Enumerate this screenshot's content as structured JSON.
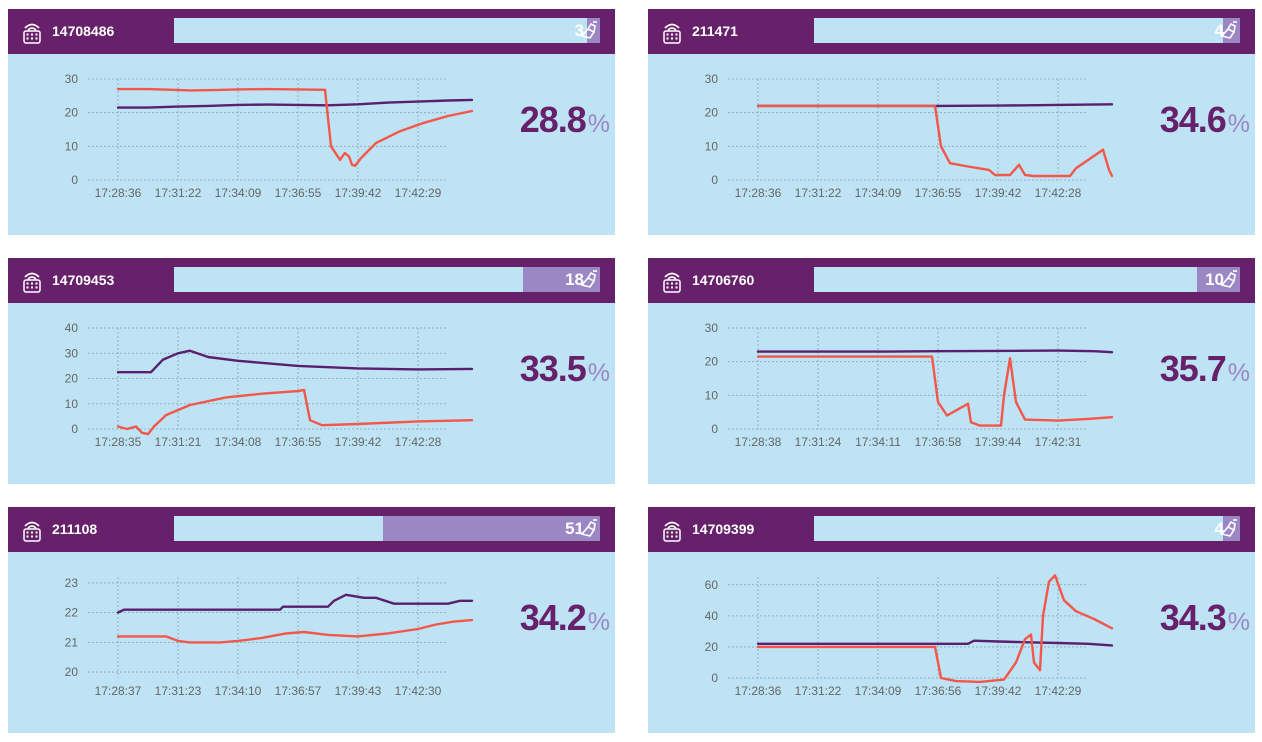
{
  "colors": {
    "header": "#67206a",
    "panel": "#bde3f4",
    "bar_fill": "#9a87c4",
    "series_dark": "#5a1f6e",
    "series_red": "#f5564a"
  },
  "icons": {
    "device": "device-wifi-icon",
    "bar": "hand-sanitizer-icon"
  },
  "devices": [
    {
      "id": "14708486",
      "bar_value": 3,
      "bar_label": "3",
      "humidity": "28.8",
      "pct_symbol": "%",
      "chart_data": {
        "type": "line",
        "xlabels": [
          "17:28:36",
          "17:31:22",
          "17:34:09",
          "17:36:55",
          "17:39:42",
          "17:42:29"
        ],
        "yticks": [
          0,
          10,
          20,
          30
        ],
        "ylim": [
          0,
          30
        ],
        "series": [
          {
            "color": "#5a1f6e",
            "points": [
              [
                0,
                21.5
              ],
              [
                0.5,
                21.5
              ],
              [
                1,
                21.8
              ],
              [
                1.5,
                22
              ],
              [
                2,
                22.3
              ],
              [
                2.5,
                22.4
              ],
              [
                3,
                22.3
              ],
              [
                3.5,
                22.2
              ],
              [
                4,
                22.5
              ],
              [
                4.5,
                23
              ],
              [
                5,
                23.3
              ],
              [
                5.5,
                23.6
              ],
              [
                5.9,
                23.8
              ]
            ]
          },
          {
            "color": "#f5564a",
            "points": [
              [
                0,
                27
              ],
              [
                0.5,
                27
              ],
              [
                0.9,
                26.8
              ],
              [
                1.2,
                26.6
              ],
              [
                1.6,
                26.7
              ],
              [
                2,
                26.9
              ],
              [
                2.5,
                27
              ],
              [
                3,
                26.9
              ],
              [
                3.45,
                26.8
              ],
              [
                3.55,
                10
              ],
              [
                3.7,
                6
              ],
              [
                3.78,
                8
              ],
              [
                3.85,
                7
              ],
              [
                3.9,
                4.5
              ],
              [
                3.95,
                4.2
              ],
              [
                4.05,
                6.5
              ],
              [
                4.3,
                11
              ],
              [
                4.7,
                14.5
              ],
              [
                5.1,
                17
              ],
              [
                5.5,
                19
              ],
              [
                5.9,
                20.5
              ]
            ]
          }
        ]
      }
    },
    {
      "id": "211471",
      "bar_value": 4,
      "bar_label": "4",
      "humidity": "34.6",
      "pct_symbol": "%",
      "chart_data": {
        "type": "line",
        "xlabels": [
          "17:28:36",
          "17:31:22",
          "17:34:09",
          "17:36:55",
          "17:39:42",
          "17:42:28"
        ],
        "yticks": [
          0,
          10,
          20,
          30
        ],
        "ylim": [
          0,
          30
        ],
        "series": [
          {
            "color": "#5a1f6e",
            "points": [
              [
                0,
                22
              ],
              [
                1,
                22
              ],
              [
                2,
                22
              ],
              [
                3,
                22
              ],
              [
                4,
                22.1
              ],
              [
                5,
                22.3
              ],
              [
                5.9,
                22.5
              ]
            ]
          },
          {
            "color": "#f5564a",
            "points": [
              [
                0,
                22
              ],
              [
                1,
                22
              ],
              [
                2,
                22
              ],
              [
                2.95,
                22
              ],
              [
                3.05,
                10
              ],
              [
                3.2,
                5
              ],
              [
                3.5,
                4
              ],
              [
                3.85,
                3
              ],
              [
                3.95,
                1.5
              ],
              [
                4.2,
                1.5
              ],
              [
                4.35,
                4.5
              ],
              [
                4.45,
                1.5
              ],
              [
                4.6,
                1.2
              ],
              [
                5,
                1.2
              ],
              [
                5.2,
                1.2
              ],
              [
                5.3,
                3.5
              ],
              [
                5.75,
                9
              ],
              [
                5.85,
                3
              ],
              [
                5.9,
                1.2
              ]
            ]
          }
        ]
      }
    },
    {
      "id": "14709453",
      "bar_value": 18,
      "bar_label": "18",
      "humidity": "33.5",
      "pct_symbol": "%",
      "chart_data": {
        "type": "line",
        "xlabels": [
          "17:28:35",
          "17:31:21",
          "17:34:08",
          "17:36:55",
          "17:39:42",
          "17:42:28"
        ],
        "yticks": [
          0,
          10,
          20,
          30,
          40
        ],
        "ylim": [
          0,
          40
        ],
        "series": [
          {
            "color": "#5a1f6e",
            "points": [
              [
                0,
                22.5
              ],
              [
                0.55,
                22.5
              ],
              [
                0.75,
                27.5
              ],
              [
                1,
                30
              ],
              [
                1.2,
                31
              ],
              [
                1.5,
                28.5
              ],
              [
                2,
                27
              ],
              [
                3,
                25
              ],
              [
                4,
                24
              ],
              [
                5,
                23.6
              ],
              [
                5.9,
                23.8
              ]
            ]
          },
          {
            "color": "#f5564a",
            "points": [
              [
                0,
                1
              ],
              [
                0.15,
                0
              ],
              [
                0.3,
                1
              ],
              [
                0.4,
                -1.5
              ],
              [
                0.5,
                -2
              ],
              [
                0.6,
                1
              ],
              [
                0.8,
                5.5
              ],
              [
                1.2,
                9.5
              ],
              [
                1.8,
                12.5
              ],
              [
                2.4,
                14
              ],
              [
                3,
                15
              ],
              [
                3.1,
                15.5
              ],
              [
                3.2,
                3.5
              ],
              [
                3.4,
                1.5
              ],
              [
                4,
                2
              ],
              [
                5,
                3
              ],
              [
                5.9,
                3.5
              ]
            ]
          }
        ]
      }
    },
    {
      "id": "14706760",
      "bar_value": 10,
      "bar_label": "10",
      "humidity": "35.7",
      "pct_symbol": "%",
      "chart_data": {
        "type": "line",
        "xlabels": [
          "17:28:38",
          "17:31:24",
          "17:34:11",
          "17:36:58",
          "17:39:44",
          "17:42:31"
        ],
        "yticks": [
          0,
          10,
          20,
          30
        ],
        "ylim": [
          0,
          30
        ],
        "series": [
          {
            "color": "#5a1f6e",
            "points": [
              [
                0,
                23
              ],
              [
                1,
                23
              ],
              [
                2,
                23
              ],
              [
                3,
                23.1
              ],
              [
                4,
                23.2
              ],
              [
                5,
                23.3
              ],
              [
                5.6,
                23.1
              ],
              [
                5.9,
                22.8
              ]
            ]
          },
          {
            "color": "#f5564a",
            "points": [
              [
                0,
                21.5
              ],
              [
                1,
                21.5
              ],
              [
                2,
                21.5
              ],
              [
                2.9,
                21.5
              ],
              [
                3,
                8
              ],
              [
                3.15,
                4
              ],
              [
                3.35,
                6
              ],
              [
                3.5,
                7.5
              ],
              [
                3.55,
                2
              ],
              [
                3.7,
                1
              ],
              [
                4.05,
                1
              ],
              [
                4.1,
                10
              ],
              [
                4.2,
                21
              ],
              [
                4.3,
                8
              ],
              [
                4.45,
                2.8
              ],
              [
                5,
                2.5
              ],
              [
                5.5,
                3
              ],
              [
                5.9,
                3.5
              ]
            ]
          }
        ]
      }
    },
    {
      "id": "211108",
      "bar_value": 51,
      "bar_label": "51",
      "humidity": "34.2",
      "pct_symbol": "%",
      "chart_data": {
        "type": "line",
        "xlabels": [
          "17:28:37",
          "17:31:23",
          "17:34:10",
          "17:36:57",
          "17:39:43",
          "17:42:30"
        ],
        "yticks": [
          20,
          21,
          22,
          23
        ],
        "ylim": [
          19.8,
          23.2
        ],
        "series": [
          {
            "color": "#5a1f6e",
            "points": [
              [
                0,
                22
              ],
              [
                0.1,
                22.1
              ],
              [
                0.2,
                22.1
              ],
              [
                2.7,
                22.1
              ],
              [
                2.75,
                22.2
              ],
              [
                3.5,
                22.2
              ],
              [
                3.6,
                22.4
              ],
              [
                3.8,
                22.6
              ],
              [
                4.1,
                22.5
              ],
              [
                4.3,
                22.5
              ],
              [
                4.6,
                22.3
              ],
              [
                5.5,
                22.3
              ],
              [
                5.7,
                22.4
              ],
              [
                5.9,
                22.4
              ]
            ]
          },
          {
            "color": "#f5564a",
            "points": [
              [
                0,
                21.2
              ],
              [
                0.5,
                21.2
              ],
              [
                0.8,
                21.2
              ],
              [
                1,
                21.05
              ],
              [
                1.2,
                21
              ],
              [
                1.7,
                21
              ],
              [
                2.0,
                21.05
              ],
              [
                2.4,
                21.15
              ],
              [
                2.8,
                21.3
              ],
              [
                3.1,
                21.35
              ],
              [
                3.5,
                21.25
              ],
              [
                4,
                21.2
              ],
              [
                4.5,
                21.3
              ],
              [
                5,
                21.45
              ],
              [
                5.3,
                21.6
              ],
              [
                5.6,
                21.7
              ],
              [
                5.9,
                21.75
              ]
            ]
          }
        ]
      }
    },
    {
      "id": "14709399",
      "bar_value": 4,
      "bar_label": "4",
      "humidity": "34.3",
      "pct_symbol": "%",
      "chart_data": {
        "type": "line",
        "xlabels": [
          "17:28:36",
          "17:31:22",
          "17:34:09",
          "17:36:56",
          "17:39:42",
          "17:42:29"
        ],
        "yticks": [
          0,
          20,
          40,
          60
        ],
        "ylim": [
          0,
          65
        ],
        "series": [
          {
            "color": "#5a1f6e",
            "points": [
              [
                0,
                22
              ],
              [
                1,
                22
              ],
              [
                2,
                22
              ],
              [
                3,
                22
              ],
              [
                3.5,
                22
              ],
              [
                3.6,
                24
              ],
              [
                4,
                23.5
              ],
              [
                4.5,
                23
              ],
              [
                5,
                22.5
              ],
              [
                5.5,
                22
              ],
              [
                5.9,
                21
              ]
            ]
          },
          {
            "color": "#f5564a",
            "points": [
              [
                0,
                20
              ],
              [
                1,
                20
              ],
              [
                2,
                20
              ],
              [
                2.95,
                20
              ],
              [
                3.05,
                0
              ],
              [
                3.3,
                -2
              ],
              [
                3.7,
                -2.5
              ],
              [
                4.1,
                -1
              ],
              [
                4.3,
                10
              ],
              [
                4.45,
                25
              ],
              [
                4.55,
                28
              ],
              [
                4.6,
                10
              ],
              [
                4.7,
                5
              ],
              [
                4.75,
                40
              ],
              [
                4.85,
                62
              ],
              [
                4.95,
                66
              ],
              [
                5.1,
                50
              ],
              [
                5.3,
                43
              ],
              [
                5.6,
                38
              ],
              [
                5.9,
                32
              ]
            ]
          }
        ]
      }
    }
  ]
}
